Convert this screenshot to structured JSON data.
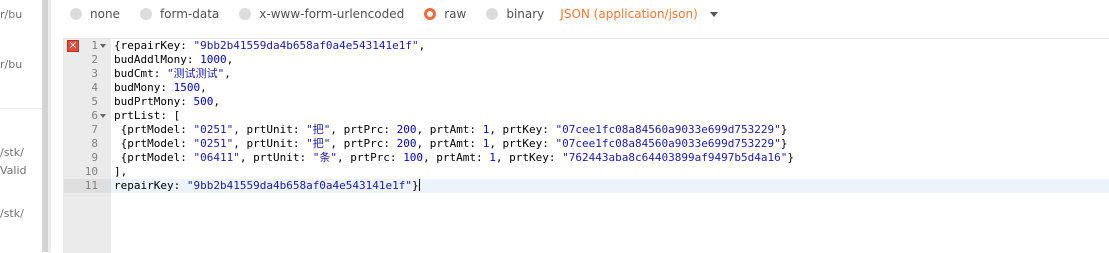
{
  "sidebar": {
    "fragments": [
      "r/bu",
      "r/bu",
      "/stk/",
      "Valid",
      "/stk/"
    ]
  },
  "body_types": {
    "options": [
      {
        "label": "none",
        "selected": false
      },
      {
        "label": "form-data",
        "selected": false
      },
      {
        "label": "x-www-form-urlencoded",
        "selected": false
      },
      {
        "label": "raw",
        "selected": true
      },
      {
        "label": "binary",
        "selected": false
      }
    ],
    "format_label": "JSON (application/json)",
    "accent_color": "#f26b3a"
  },
  "editor": {
    "active_line": 11,
    "error_line": 1,
    "lines": [
      {
        "n": "1",
        "fold": true,
        "code": [
          [
            "p",
            "{repairKey: "
          ],
          [
            "s",
            "\"9bb2b41559da4b658af0a4e543141e1f\""
          ],
          [
            "p",
            ","
          ]
        ]
      },
      {
        "n": "2",
        "code": [
          [
            "p",
            "budAddlMony: "
          ],
          [
            "n",
            "1000"
          ],
          [
            "p",
            ","
          ]
        ]
      },
      {
        "n": "3",
        "code": [
          [
            "p",
            "budCmt: "
          ],
          [
            "s",
            "\"测试测试\""
          ],
          [
            "p",
            ","
          ]
        ]
      },
      {
        "n": "4",
        "code": [
          [
            "p",
            "budMony: "
          ],
          [
            "n",
            "1500"
          ],
          [
            "p",
            ","
          ]
        ]
      },
      {
        "n": "5",
        "code": [
          [
            "p",
            "budPrtMony: "
          ],
          [
            "n",
            "500"
          ],
          [
            "p",
            ","
          ]
        ]
      },
      {
        "n": "6",
        "fold": true,
        "code": [
          [
            "p",
            "prtList: ["
          ]
        ]
      },
      {
        "n": "7",
        "code": [
          [
            "p",
            " {prtModel: "
          ],
          [
            "s",
            "\"0251\""
          ],
          [
            "p",
            ", prtUnit: "
          ],
          [
            "s",
            "\"把\""
          ],
          [
            "p",
            ", prtPrc: "
          ],
          [
            "n",
            "200"
          ],
          [
            "p",
            ", prtAmt: "
          ],
          [
            "n",
            "1"
          ],
          [
            "p",
            ", prtKey: "
          ],
          [
            "s",
            "\"07cee1fc08a84560a9033e699d753229\""
          ],
          [
            "p",
            "}"
          ]
        ]
      },
      {
        "n": "8",
        "code": [
          [
            "p",
            " {prtModel: "
          ],
          [
            "s",
            "\"0251\""
          ],
          [
            "p",
            ", prtUnit: "
          ],
          [
            "s",
            "\"把\""
          ],
          [
            "p",
            ", prtPrc: "
          ],
          [
            "n",
            "200"
          ],
          [
            "p",
            ", prtAmt: "
          ],
          [
            "n",
            "1"
          ],
          [
            "p",
            ", prtKey: "
          ],
          [
            "s",
            "\"07cee1fc08a84560a9033e699d753229\""
          ],
          [
            "p",
            "}"
          ]
        ]
      },
      {
        "n": "9",
        "code": [
          [
            "p",
            " {prtModel: "
          ],
          [
            "s",
            "\"06411\""
          ],
          [
            "p",
            ", prtUnit: "
          ],
          [
            "s",
            "\"条\""
          ],
          [
            "p",
            ", prtPrc: "
          ],
          [
            "n",
            "100"
          ],
          [
            "p",
            ", prtAmt: "
          ],
          [
            "n",
            "1"
          ],
          [
            "p",
            ", prtKey: "
          ],
          [
            "s",
            "\"762443aba8c64403899af9497b5d4a16\""
          ],
          [
            "p",
            "}"
          ]
        ]
      },
      {
        "n": "10",
        "code": [
          [
            "p",
            "],"
          ]
        ]
      },
      {
        "n": "11",
        "code": [
          [
            "p",
            "repairKey: "
          ],
          [
            "s",
            "\"9bb2b41559da4b658af0a4e543141e1f\""
          ],
          [
            "p",
            "}"
          ]
        ]
      }
    ]
  }
}
